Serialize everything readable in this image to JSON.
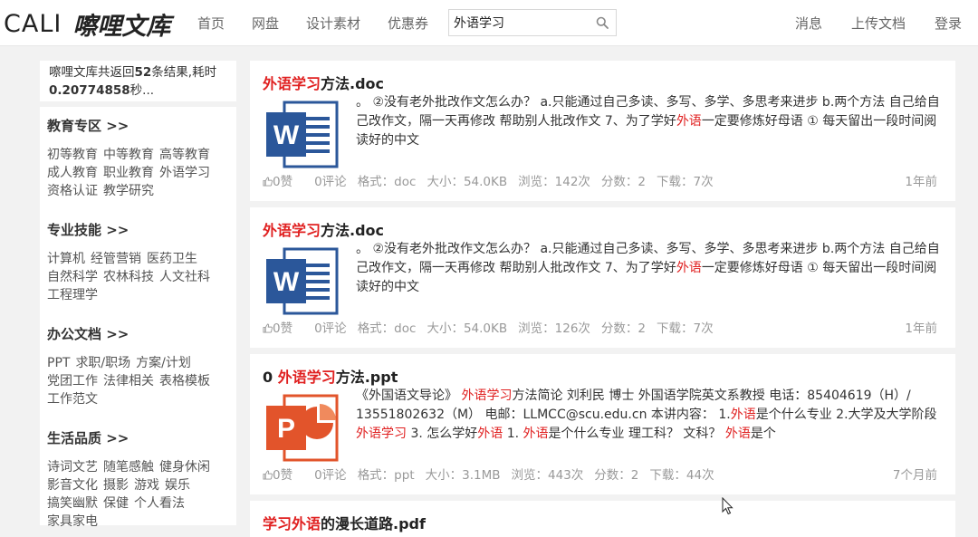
{
  "header": {
    "logo_en": "CALI",
    "logo_cn": "嚓哩文库",
    "nav": [
      "首页",
      "网盘",
      "设计素材",
      "优惠券"
    ],
    "search_value": "外语学习",
    "right_nav": [
      "消息",
      "上传文档",
      "登录"
    ]
  },
  "summary": {
    "prefix": "嚓哩文库共返回",
    "count": "52",
    "middle": "条结果,耗时",
    "seconds": "0.20774858",
    "suffix": "秒..."
  },
  "categories": [
    {
      "title": "教育专区 >>",
      "items": [
        "初等教育",
        "中等教育",
        "高等教育",
        "成人教育",
        "职业教育",
        "外语学习",
        "资格认证",
        "教学研究"
      ]
    },
    {
      "title": "专业技能 >>",
      "items": [
        "计算机",
        "经管营销",
        "医药卫生",
        "自然科学",
        "农林科技",
        "人文社科",
        "工程理学"
      ]
    },
    {
      "title": "办公文档 >>",
      "items": [
        "PPT",
        "求职/职场",
        "方案/计划",
        "党团工作",
        "法律相关",
        "表格模板",
        "工作范文"
      ]
    },
    {
      "title": "生活品质 >>",
      "items": [
        "诗词文艺",
        "随笔感触",
        "健身休闲",
        "影音文化",
        "摄影",
        "游戏",
        "娱乐",
        "搞笑幽默",
        "保健",
        "个人看法",
        "家具家电"
      ]
    }
  ],
  "results": [
    {
      "type": "doc",
      "title_parts": [
        {
          "t": "外语学习",
          "hl": true
        },
        {
          "t": "方法.doc",
          "hl": false
        }
      ],
      "snippet_parts": [
        {
          "t": "。 ②没有老外批改作文怎么办？ a.只能通过自己多读、多写、多学、多思考来进步 b.两个方法 自己给自己改作文，隔一天再修改 帮助别人批改作文 7、为了学好",
          "hl": false
        },
        {
          "t": "外语",
          "hl": true
        },
        {
          "t": "一定要修炼好母语 ① 每天留出一段时间阅读好的中文",
          "hl": false
        }
      ],
      "meta": {
        "likes": "0赞",
        "comments": "0评论",
        "format": "格式：doc",
        "size": "大小：54.0KB",
        "views": "浏览：142次",
        "score": "分数：2",
        "downloads": "下载：7次"
      },
      "time": "1年前"
    },
    {
      "type": "doc",
      "title_parts": [
        {
          "t": "外语学习",
          "hl": true
        },
        {
          "t": "方法.doc",
          "hl": false
        }
      ],
      "snippet_parts": [
        {
          "t": "。 ②没有老外批改作文怎么办？ a.只能通过自己多读、多写、多学、多思考来进步 b.两个方法 自己给自己改作文，隔一天再修改 帮助别人批改作文 7、为了学好",
          "hl": false
        },
        {
          "t": "外语",
          "hl": true
        },
        {
          "t": "一定要修炼好母语 ① 每天留出一段时间阅读好的中文",
          "hl": false
        }
      ],
      "meta": {
        "likes": "0赞",
        "comments": "0评论",
        "format": "格式：doc",
        "size": "大小：54.0KB",
        "views": "浏览：126次",
        "score": "分数：2",
        "downloads": "下载：7次"
      },
      "time": "1年前"
    },
    {
      "type": "ppt",
      "title_parts": [
        {
          "t": "0 ",
          "hl": false
        },
        {
          "t": "外语学习",
          "hl": true
        },
        {
          "t": "方法.ppt",
          "hl": false
        }
      ],
      "snippet_parts": [
        {
          "t": "《外国语文导论》 ",
          "hl": false
        },
        {
          "t": "外语学习",
          "hl": true
        },
        {
          "t": "方法简论 刘利民 博士 外国语学院英文系教授 电话：85404619（H）/ 13551802632（M） 电邮：LLMCC@scu.edu.cn 本讲内容： 1.",
          "hl": false
        },
        {
          "t": "外语",
          "hl": true
        },
        {
          "t": "是个什么专业 2.大学及大学阶段",
          "hl": false
        },
        {
          "t": "外语学习",
          "hl": true
        },
        {
          "t": " 3. 怎么学好",
          "hl": false
        },
        {
          "t": "外语",
          "hl": true
        },
        {
          "t": " 1. ",
          "hl": false
        },
        {
          "t": "外语",
          "hl": true
        },
        {
          "t": "是个什么专业 理工科？ 文科？ ",
          "hl": false
        },
        {
          "t": "外语",
          "hl": true
        },
        {
          "t": "是个",
          "hl": false
        }
      ],
      "meta": {
        "likes": "0赞",
        "comments": "0评论",
        "format": "格式：ppt",
        "size": "大小：3.1MB",
        "views": "浏览：443次",
        "score": "分数：2",
        "downloads": "下载：44次"
      },
      "time": "7个月前"
    },
    {
      "type": "pdf",
      "title_parts": [
        {
          "t": "学习外语",
          "hl": true
        },
        {
          "t": "的漫长道路.pdf",
          "hl": false
        }
      ]
    }
  ]
}
